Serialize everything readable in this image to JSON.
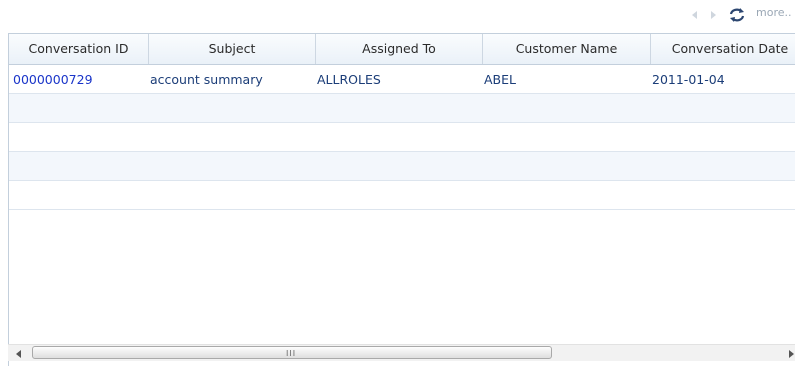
{
  "toolbar": {
    "more_label": "more..",
    "icons": [
      "chevron-left-icon",
      "chevron-right-icon",
      "refresh-icon"
    ]
  },
  "table": {
    "columns": [
      "Conversation ID",
      "Subject",
      "Assigned To",
      "Customer Name",
      "Conversation Date"
    ],
    "rows": [
      {
        "conversation_id": "0000000729",
        "subject": "account summary",
        "assigned_to": "ALLROLES",
        "customer_name": "ABEL",
        "conversation_date": "2011-01-04"
      }
    ]
  },
  "scrollbar": {
    "grip": "III"
  },
  "colors": {
    "link": "#1a35c9",
    "header_bg": "#eef3f9",
    "alt_row": "#f3f7fc",
    "border": "#c3cfdc"
  }
}
